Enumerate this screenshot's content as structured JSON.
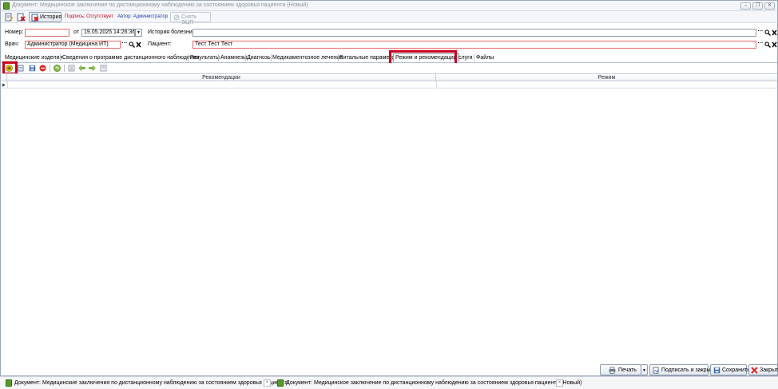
{
  "window": {
    "title": "Документ: Медицинское заключение по дистанционному наблюдению за состоянием здоровья пациента (Новый)",
    "controls": [
      "minimize",
      "restore",
      "close"
    ]
  },
  "toolbar": {
    "history_label": "История",
    "signature_label": "Подпись: Отсутствует",
    "author_label": "Автор: Администратор",
    "remove_ecp_label": "Снять ЭЦП"
  },
  "form": {
    "number_label": "Номер:",
    "number_value": "",
    "date_from_label": "от",
    "date_value": "19.05.2025 14:26:36",
    "case_history_label": "История болезни:",
    "case_history_value": "",
    "doctor_label": "Врач:",
    "doctor_value": "Администратор (Медицина ИТ)",
    "patient_label": "Пациент:",
    "patient_value": "Тест Тест Тест",
    "dots": "···",
    "search": "🔍",
    "clear": "✕"
  },
  "tabs": [
    {
      "label": "Медицинские изделия"
    },
    {
      "label": "Сведения о программе дистанционного наблюдения"
    },
    {
      "label": "Результаты"
    },
    {
      "label": "Анамнезы"
    },
    {
      "label": "Диагнозы"
    },
    {
      "label": "Медикаментозное лечение"
    },
    {
      "label": "Витальные параметр"
    },
    {
      "label": "Режим и рекомендации",
      "active": true
    },
    {
      "label": "слуги"
    },
    {
      "label": "Файлы"
    }
  ],
  "grid": {
    "columns": [
      "Рекомендации",
      "Режим"
    ],
    "row_marker": "▶"
  },
  "bottom": {
    "print_label": "Печать",
    "sign_close_label": "Подписать и закрыть",
    "save_label": "Сохранить",
    "close_label": "Закрыть"
  },
  "taskbar": {
    "items": [
      {
        "label": "Документ: Медицинские заключения по дистанционному наблюдению за состоянием здоровья пациента"
      },
      {
        "label": "Документ: Медицинское заключение по дистанционному наблюдению за состоянием здоровья пациента (Новый)"
      }
    ]
  },
  "colors": {
    "highlight": "#c8001e",
    "required_border": "#e56b6b",
    "signature_text": "#c8001e",
    "author_text": "#1a3fa8"
  }
}
